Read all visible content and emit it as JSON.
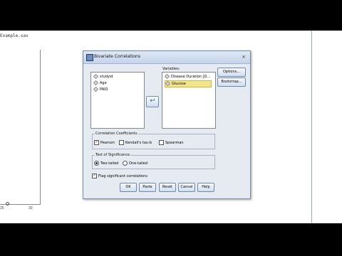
{
  "background": {
    "filename": "Example.sav",
    "x_ticks": [
      "25",
      "30"
    ]
  },
  "dialog": {
    "title": "Bivariate Correlations",
    "source_list": [
      {
        "label": "studyid",
        "icon": "ruler-icon"
      },
      {
        "label": "Age",
        "icon": "ruler-icon"
      },
      {
        "label": "PAID",
        "icon": "ruler-icon"
      }
    ],
    "variables_label": "Variables:",
    "target_list": [
      {
        "label": "Disease Duration [D...",
        "icon": "ruler-icon",
        "selected": false
      },
      {
        "label": "Glucose",
        "icon": "ruler-icon",
        "selected": true
      }
    ],
    "move_arrow": "↩",
    "side_buttons": {
      "options": "Options...",
      "bootstrap": "Bootstrap..."
    },
    "correlation_group": {
      "title": "Correlation Coefficients",
      "pearson": {
        "label": "Pearson",
        "checked": true
      },
      "kendall": {
        "label": "Kendall's tau-b",
        "checked": false
      },
      "spearman": {
        "label": "Spearman",
        "checked": false
      }
    },
    "significance_group": {
      "title": "Test of Significance",
      "two_tailed": {
        "label": "Two-tailed",
        "selected": true
      },
      "one_tailed": {
        "label": "One-tailed",
        "selected": false
      }
    },
    "flag_significant": {
      "label": "Flag significant correlations",
      "checked": true
    },
    "buttons": {
      "ok": "OK",
      "paste": "Paste",
      "reset": "Reset",
      "cancel": "Cancel",
      "help": "Help"
    },
    "close_glyph": "×",
    "check_glyph": "✓"
  }
}
